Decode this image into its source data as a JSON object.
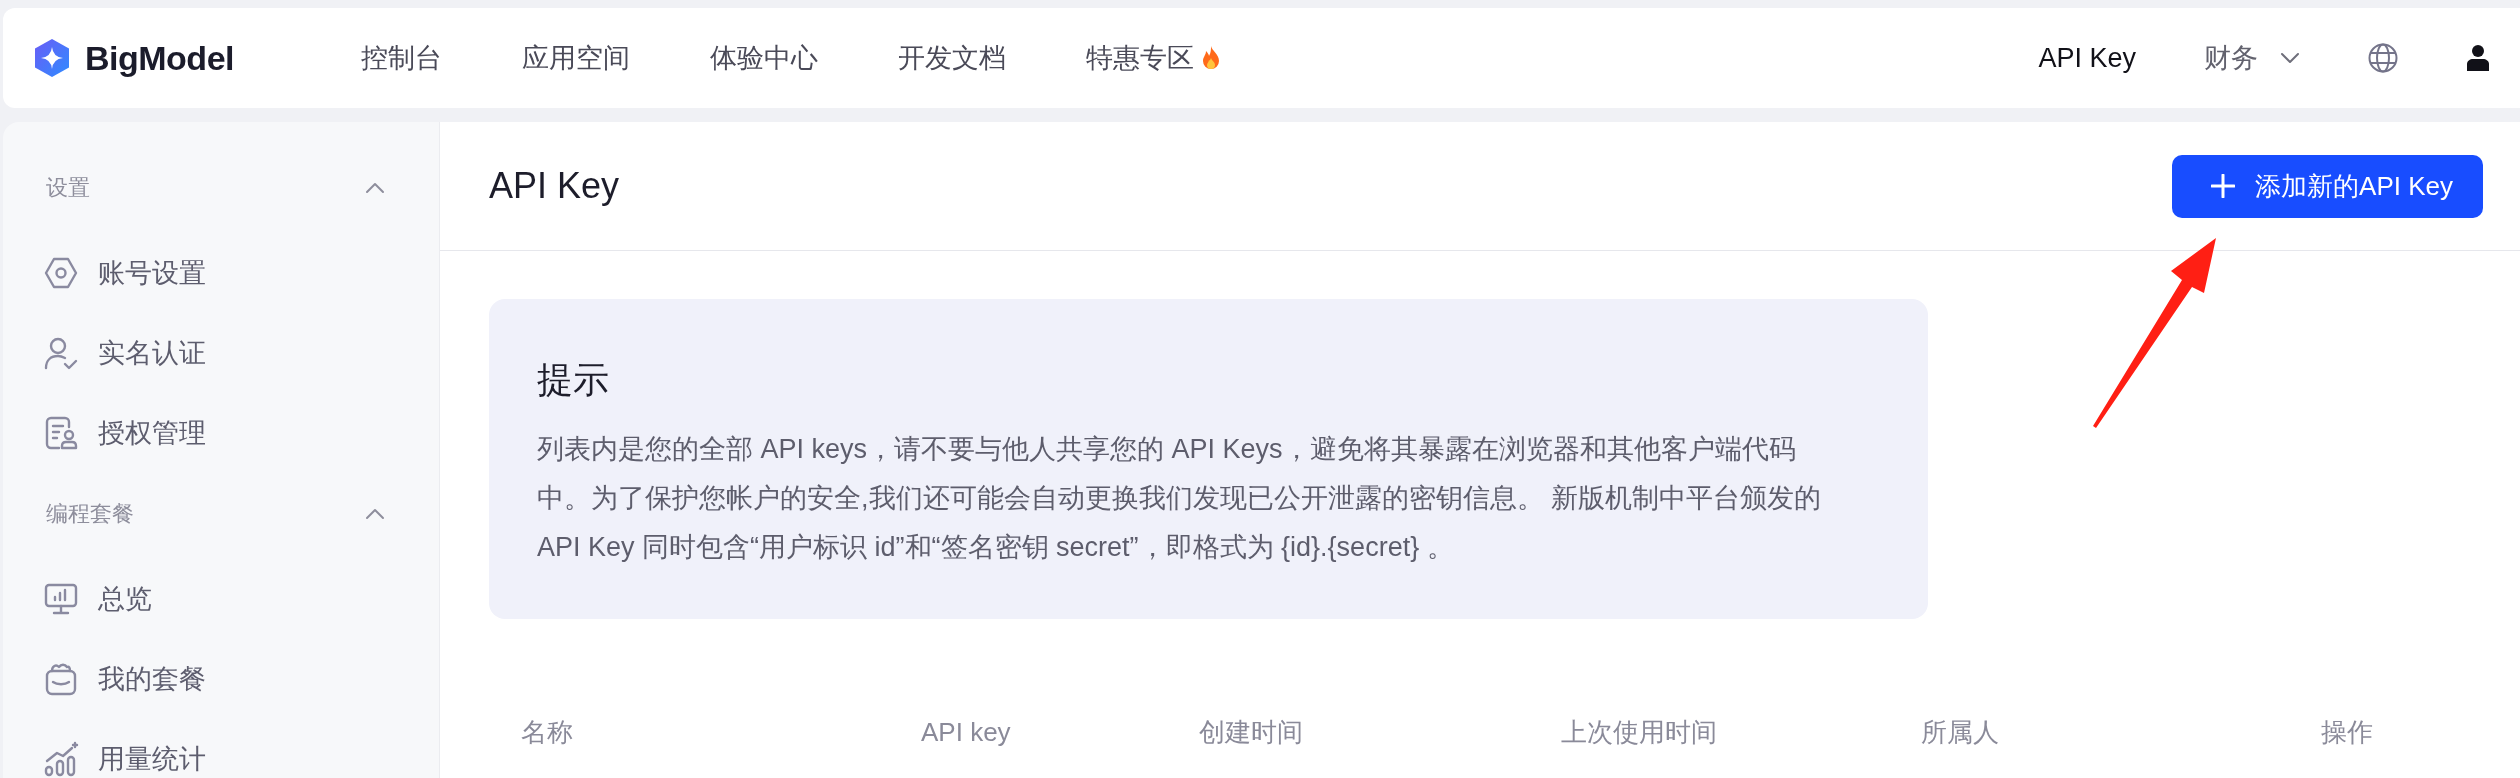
{
  "header": {
    "logo": "BigModel",
    "nav": [
      {
        "label": "控制台",
        "hot": false
      },
      {
        "label": "应用空间",
        "hot": false
      },
      {
        "label": "体验中心",
        "hot": false
      },
      {
        "label": "开发文档",
        "hot": false
      },
      {
        "label": "特惠专区",
        "hot": true
      }
    ],
    "links": [
      {
        "kind": "link",
        "label": "API Key",
        "selected": true
      },
      {
        "kind": "dropdown",
        "label": "财务",
        "selected": false
      }
    ]
  },
  "sidebar": {
    "sections": [
      {
        "title": "设置",
        "expanded": true,
        "items": [
          "账号设置",
          "实名认证",
          "授权管理"
        ]
      },
      {
        "title": "编程套餐",
        "expanded": true,
        "items": [
          "总览",
          "我的套餐",
          "用量统计"
        ]
      }
    ]
  },
  "page": {
    "title": "API Key",
    "add_button": "添加新的API Key"
  },
  "notice": {
    "title": "提示",
    "text": "列表内是您的全部 API keys，请不要与他人共享您的 API Keys，避免将其暴露在浏览器和其他客户端代码中。为了保护您帐户的安全,我们还可能会自动更换我们发现已公开泄露的密钥信息。 新版机制中平台颁发的API Key 同时包含“用户标识 id”和“签名密钥 secret”，即格式为 {id}.{secret} 。"
  },
  "table": {
    "columns": [
      "名称",
      "API key",
      "创建时间",
      "上次使用时间",
      "所属人",
      "操作"
    ]
  },
  "annotations": [
    {
      "kind": "arrow"
    }
  ]
}
